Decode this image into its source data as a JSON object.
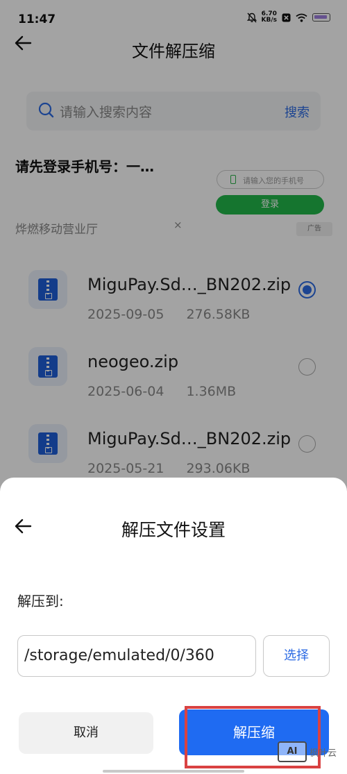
{
  "status_bar": {
    "time": "11:47",
    "net_speed_value": "6.70",
    "net_speed_unit": "KB/s",
    "icons": [
      "mute-bell-icon",
      "close-box-icon",
      "wifi-icon",
      "battery-icon"
    ]
  },
  "header": {
    "title": "文件解压缩",
    "back_icon": "back-arrow-icon"
  },
  "search": {
    "placeholder": "请输入搜索内容",
    "button_label": "搜索"
  },
  "login_banner": {
    "title": "请先登录手机号：一…",
    "phone_placeholder": "请输入您的手机号",
    "login_button": "登录",
    "shop_name": "烨燃移动营业厅",
    "close_symbol": "×",
    "ad_tag": "广告"
  },
  "files": [
    {
      "name": "MiguPay.Sd…_BN202.zip",
      "date": "2025-09-05",
      "size": "276.58KB",
      "selected": true
    },
    {
      "name": "neogeo.zip",
      "date": "2025-06-04",
      "size": "1.36MB",
      "selected": false
    },
    {
      "name": "MiguPay.Sd…_BN202.zip",
      "date": "2025-05-21",
      "size": "293.06KB",
      "selected": false
    }
  ],
  "dialog": {
    "title": "解压文件设置",
    "extract_to_label": "解压到:",
    "path_value": "/storage/emulated/0/360",
    "choose_button": "选择",
    "cancel_button": "取消",
    "extract_button": "解压缩"
  },
  "watermark": {
    "logo_text": "AI",
    "text": "枫叶云"
  },
  "colors": {
    "accent_blue": "#2d6be3",
    "primary_button": "#1f6bf2",
    "login_green": "#22b84a",
    "highlight_red": "#d94242"
  }
}
